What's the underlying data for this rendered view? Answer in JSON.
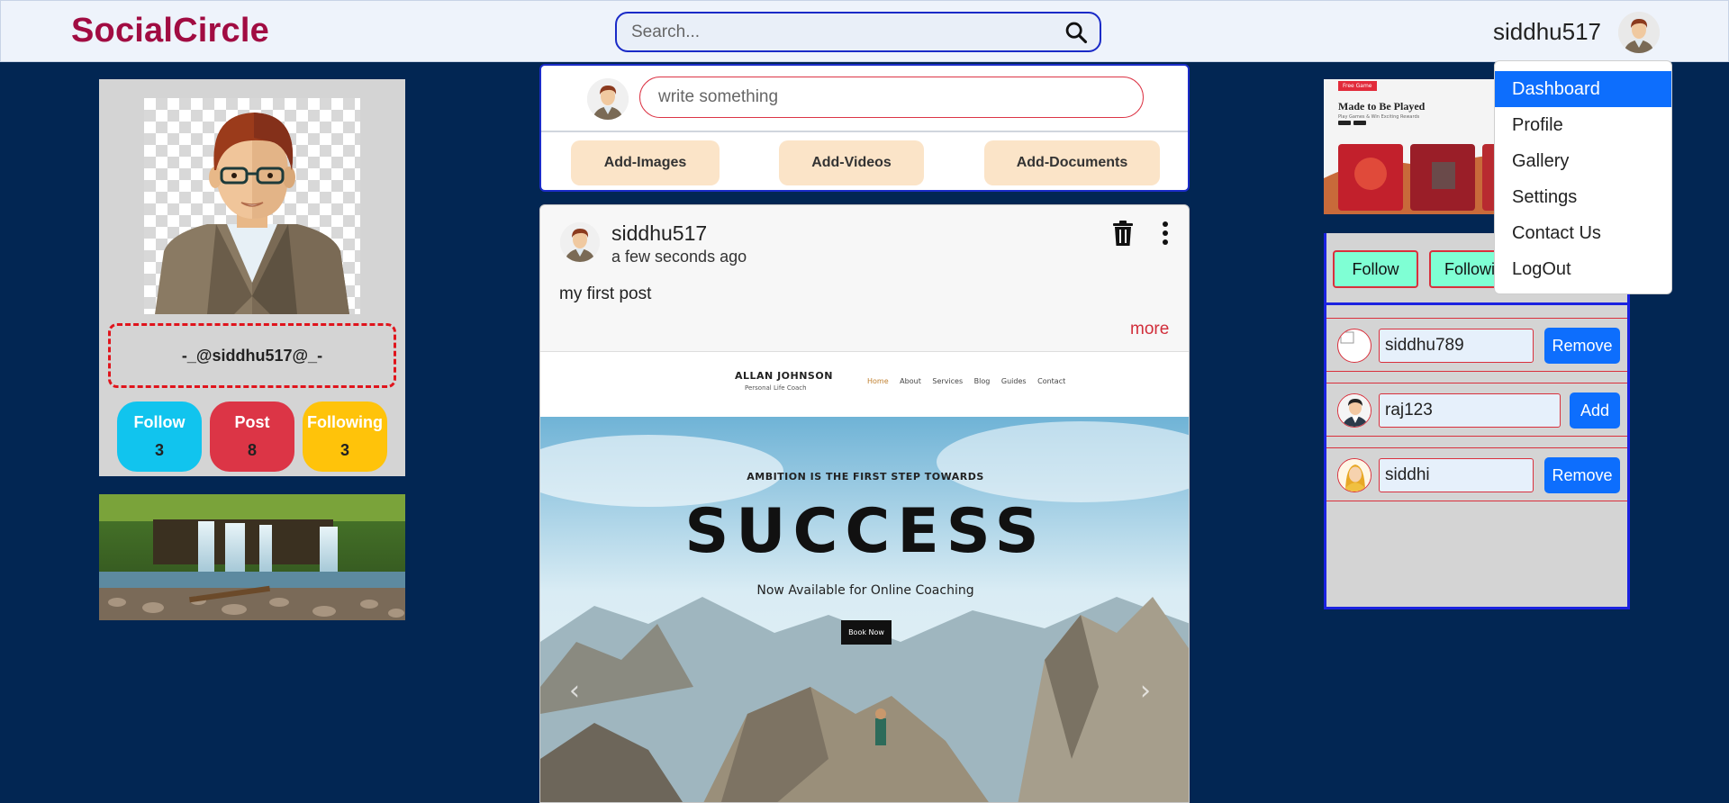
{
  "app": {
    "brand": "SocialCircle"
  },
  "navbar": {
    "search_placeholder": "Search...",
    "username": "siddhu517"
  },
  "dropdown": {
    "items": [
      {
        "label": "Dashboard",
        "active": true
      },
      {
        "label": "Profile"
      },
      {
        "label": "Gallery"
      },
      {
        "label": "Settings"
      },
      {
        "label": "Contact Us"
      },
      {
        "label": "LogOut"
      }
    ]
  },
  "profile": {
    "handle": "-_@siddhu517@_-",
    "stats": [
      {
        "label": "Follow",
        "value": "3"
      },
      {
        "label": "Post",
        "value": "8"
      },
      {
        "label": "Following",
        "value": "3"
      }
    ]
  },
  "composer": {
    "placeholder": "write something",
    "buttons": [
      "Add-Images",
      "Add-Videos",
      "Add-Documents"
    ]
  },
  "post": {
    "username": "siddhu517",
    "time": "a few seconds ago",
    "text": "my first post",
    "more_label": "more",
    "image": {
      "site_name": "ALLAN JOHNSON",
      "site_subtitle": "Personal Life Coach",
      "nav": [
        "Home",
        "About",
        "Services",
        "Blog",
        "Guides",
        "Contact"
      ],
      "tagline": "AMBITION IS THE FIRST STEP TOWARDS",
      "headline": "SUCCESS",
      "subheadline": "Now Available for Online Coaching",
      "cta": "Book Now"
    }
  },
  "ad": {
    "badge": "Free Game",
    "title": "Made to Be Played",
    "text": "Play Games & Win Exciting Rewards"
  },
  "follow_panel": {
    "tabs": [
      "Follow",
      "Following"
    ],
    "users": [
      {
        "name": "siddhu789",
        "action": "Remove"
      },
      {
        "name": "raj123",
        "action": "Add"
      },
      {
        "name": "siddhi",
        "action": "Remove"
      }
    ]
  },
  "colors": {
    "background": "#022653",
    "brand": "#a10c42",
    "accent_blue": "#0d6efd",
    "follow_stat": "#11c4ee",
    "post_stat": "#dc3546",
    "following_stat": "#ffc30a"
  }
}
